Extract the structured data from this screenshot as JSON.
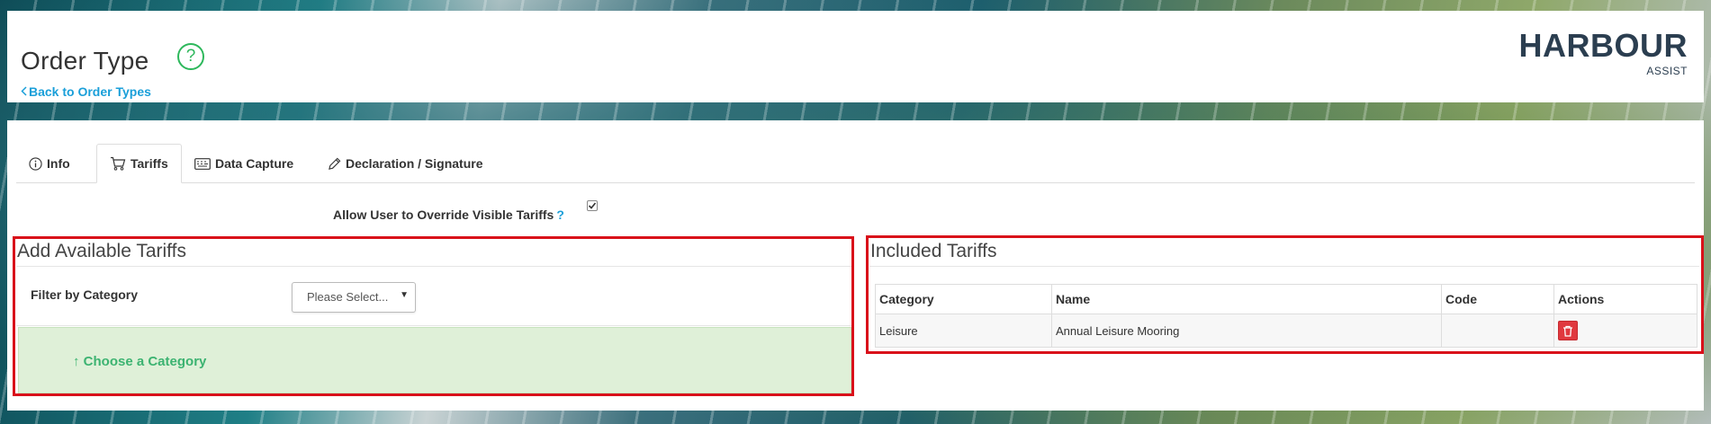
{
  "header": {
    "title": "Order Type",
    "help_icon": "?",
    "back_label": "Back to Order Types",
    "logo_main": "HARBOUR",
    "logo_sub": "ASSIST"
  },
  "tabs": [
    {
      "label": "Info",
      "icon": "info-icon",
      "active": false
    },
    {
      "label": "Tariffs",
      "icon": "cart-icon",
      "active": true
    },
    {
      "label": "Data Capture",
      "icon": "keyboard-icon",
      "active": false
    },
    {
      "label": "Declaration / Signature",
      "icon": "pen-icon",
      "active": false
    }
  ],
  "override": {
    "label": "Allow User to Override Visible Tariffs",
    "help": "?",
    "checked": true
  },
  "available": {
    "title": "Add Available Tariffs",
    "filter_label": "Filter by Category",
    "select_value": "Please Select...",
    "choose_text": "Choose a Category"
  },
  "included": {
    "title": "Included Tariffs",
    "columns": [
      "Category",
      "Name",
      "Code",
      "Actions"
    ],
    "rows": [
      {
        "category": "Leisure",
        "name": "Annual Leisure Mooring",
        "code": ""
      }
    ]
  },
  "colors": {
    "accent_green": "#2eb85c",
    "link_blue": "#1a9fd9",
    "highlight_red": "#d9101a",
    "delete_red": "#e0383e",
    "info_green_bg": "#dff0d8"
  }
}
